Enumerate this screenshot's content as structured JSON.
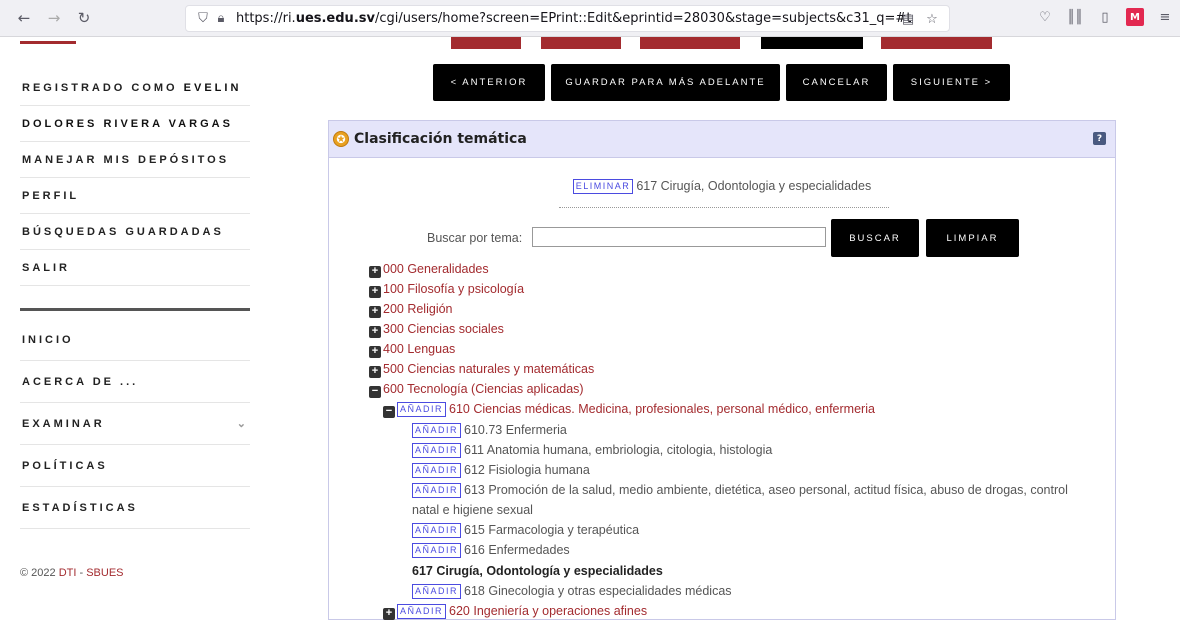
{
  "browser": {
    "url_prefix": "https://ri.",
    "url_domain": "ues.edu.sv",
    "url_rest": "/cgi/users/home?screen=EPrint::Edit&eprintid=28030&stage=subjects&c31_q=#t"
  },
  "icons": {
    "back": "back-arrow-icon",
    "forward": "forward-arrow-icon",
    "reload": "reload-icon",
    "shield": "shield-icon",
    "lock": "lock-icon",
    "reader": "reader-view-icon",
    "bookmark": "star-bookmark-icon",
    "pocket": "pocket-icon",
    "library": "library-icon",
    "sidebar": "sidebar-icon",
    "extension": "extension-icon",
    "menu": "hamburger-menu-icon"
  },
  "sidebar": {
    "user_line1_prefix": "REGISTRADO COMO ",
    "user_line1_name": "EVELIN",
    "user_line2": "DOLORES RIVERA VARGAS",
    "items": [
      "MANEJAR MIS DEPÓSITOS",
      "PERFIL",
      "BÚSQUEDAS GUARDADAS",
      "SALIR"
    ],
    "nav": [
      "INICIO",
      "ACERCA DE ...",
      "EXAMINAR",
      "POLÍTICAS",
      "ESTADÍSTICAS"
    ]
  },
  "footer": {
    "copy": "© 2022 ",
    "link1": "DTI",
    "sep": " - ",
    "link2": "SBUES"
  },
  "toolbar": {
    "prev": "< ANTERIOR",
    "save": "GUARDAR PARA MÁS ADELANTE",
    "cancel": "CANCELAR",
    "next": "SIGUIENTE >"
  },
  "panel": {
    "title": "Clasificación temática",
    "help": "?",
    "remove_label": "ELIMINAR",
    "selected_subject": "617 Cirugía, Odontologia y especialidades",
    "search_label": "Buscar por tema:",
    "search_value": "",
    "search_button": "BUSCAR",
    "clear_button": "LIMPIAR",
    "add_label": "AÑADIR"
  },
  "tree": {
    "top": [
      "000 Generalidades",
      "100 Filosofía y psicología",
      "200 Religión",
      "300 Ciencias sociales",
      "400 Lenguas",
      "500 Ciencias naturales y matemáticas",
      "600 Tecnología (Ciencias aplicadas)"
    ],
    "node_610": "610 Ciencias médicas. Medicina, profesionales, personal médico, enfermeria",
    "children_610": [
      "610.73 Enfermeria",
      "611 Anatomia humana, embriologia, citologia, histologia",
      "612 Fisiologia humana",
      "613 Promoción de la salud, medio ambiente, dietética, aseo personal, actitud física, abuso de drogas, control",
      "natal e higiene sexual",
      "615 Farmacologia y terapéutica",
      "616 Enfermedades"
    ],
    "current": "617 Cirugía, Odontología y especialidades",
    "node_618": "618 Ginecologia y otras especialidades médicas",
    "node_620": "620 Ingeniería y operaciones afines"
  }
}
